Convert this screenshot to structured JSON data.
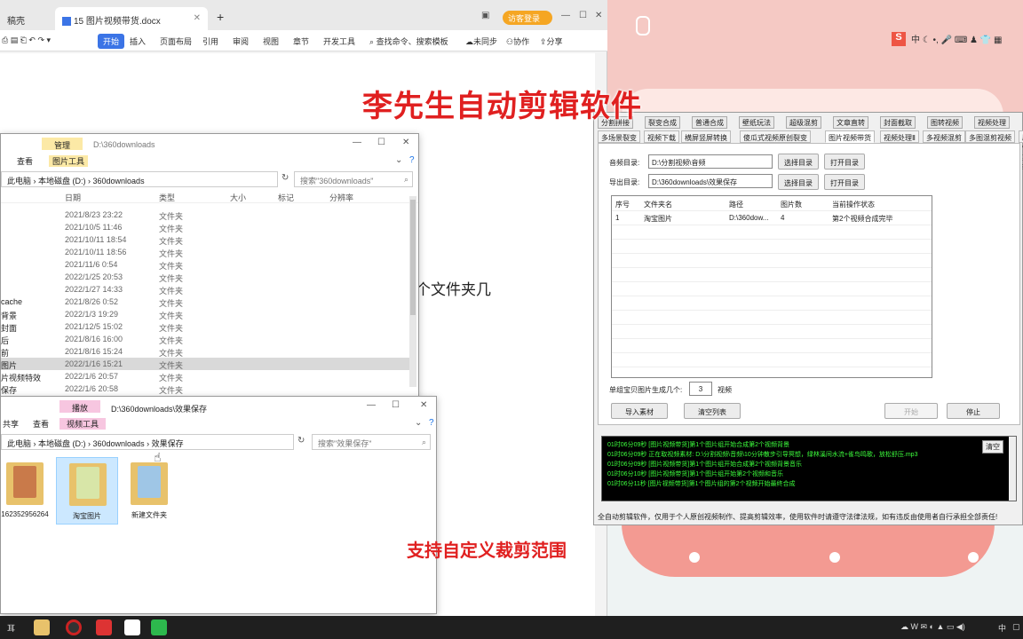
{
  "wps": {
    "tab_partial": "稿壳",
    "tab_doc": "15 图片视频带货.docx",
    "tab_add": "+",
    "guest_login": "访客登录",
    "ribbon": [
      "开始",
      "插入",
      "页面布局",
      "引用",
      "审阅",
      "视图",
      "章节",
      "开发工具"
    ],
    "search_hint": "查找命令、搜索模板",
    "sync": "未同步",
    "collab": "协作",
    "share": "分享",
    "doc_text": "个文件夹几"
  },
  "explorer1": {
    "manage": "管理",
    "path_title": "D:\\360downloads",
    "tabs": [
      "查看",
      "图片工具"
    ],
    "address": [
      "此电脑",
      "本地磁盘 (D:)",
      "360downloads"
    ],
    "search_placeholder": "搜索\"360downloads\"",
    "columns": [
      "日期",
      "类型",
      "大小",
      "标记",
      "分辨率"
    ],
    "rows": [
      {
        "name": "",
        "date": "2021/8/23 23:22",
        "type": "文件夹"
      },
      {
        "name": "",
        "date": "2021/10/5 11:46",
        "type": "文件夹"
      },
      {
        "name": "",
        "date": "2021/10/11 18:54",
        "type": "文件夹"
      },
      {
        "name": "",
        "date": "2021/10/11 18:56",
        "type": "文件夹"
      },
      {
        "name": "",
        "date": "2021/11/6 0:54",
        "type": "文件夹"
      },
      {
        "name": "",
        "date": "2022/1/25 20:53",
        "type": "文件夹"
      },
      {
        "name": "",
        "date": "2022/1/27 14:33",
        "type": "文件夹"
      },
      {
        "name": "cache",
        "date": "2021/8/26 0:52",
        "type": "文件夹"
      },
      {
        "name": "背景",
        "date": "2022/1/3 19:29",
        "type": "文件夹"
      },
      {
        "name": "封面",
        "date": "2021/12/5 15:02",
        "type": "文件夹"
      },
      {
        "name": "后",
        "date": "2021/8/16 16:00",
        "type": "文件夹"
      },
      {
        "name": "前",
        "date": "2021/8/16 15:24",
        "type": "文件夹"
      },
      {
        "name": "图片",
        "date": "2022/1/16 15:21",
        "type": "文件夹",
        "selected": true
      },
      {
        "name": "片视频特效",
        "date": "2022/1/6 20:57",
        "type": "文件夹"
      },
      {
        "name": "保存",
        "date": "2022/1/6 20:58",
        "type": "文件夹"
      }
    ]
  },
  "explorer2": {
    "manage": "播放",
    "path_title": "D:\\360downloads\\效果保存",
    "tabs": [
      "共享",
      "查看",
      "视频工具"
    ],
    "address": [
      "此电脑",
      "本地磁盘 (D:)",
      "360downloads",
      "效果保存"
    ],
    "search_placeholder": "搜索\"效果保存\"",
    "items": [
      {
        "label": "162352956264"
      },
      {
        "label": "淘宝图片",
        "selected": true
      },
      {
        "label": "新建文件夹"
      }
    ]
  },
  "app": {
    "toolbar": [
      "分割拼接",
      "裂变合成",
      "普通合成",
      "壁纸玩法",
      "超级混剪",
      "文章直转",
      "封面截取",
      "图转视频",
      "视频处理"
    ],
    "tabs": [
      "多场景裂变",
      "视频下载",
      "横屏竖屏转换",
      "傻瓜式视频原创裂变",
      "图片视频带货",
      "视频处理Ⅱ",
      "多视频混剪",
      "多图混剪视频",
      "剧情剪辑"
    ],
    "active_tab": 4,
    "audio_label": "音频目录:",
    "audio_value": "D:\\分割视频\\音频",
    "export_label": "导出目录:",
    "export_value": "D:\\360downloads\\效果保存",
    "select_dir": "选择目录",
    "open_dir": "打开目录",
    "grid_headers": [
      "序号",
      "文件夹名",
      "路径",
      "图片数",
      "当前操作状态"
    ],
    "grid_row": [
      "1",
      "淘宝图片",
      "D:\\360dow...",
      "4",
      "第2个视频合成完毕"
    ],
    "per_group_label": "单组宝贝图片生成几个:",
    "per_group_value": "3",
    "per_group_unit": "视频",
    "import_btn": "导入素材",
    "clear_btn": "清空列表",
    "start_btn": "开始",
    "stop_btn": "停止",
    "log_clear": "清空",
    "log": [
      "01时06分09秒 [图片视频带货]第1个图片组开始合成第2个视频背景",
      "01时06分09秒 正在取视频素材: D:\\分割视频\\音频\\10分钟散步引导冥想，绿林溪间水流+雀鸟鸣歌，放松舒压.mp3",
      "01时06分09秒 [图片视频带货]第1个图片组开始合成第2个视频背景音乐",
      "01时06分10秒 [图片视频带货]第1个图片组开始第2个视频和音乐",
      "01时06分11秒 [图片视频带货]第1个图片组的第2个视频开始最终合成"
    ],
    "footer": "全自动剪辑软件，仅用于个人原创视频制作、提高剪辑效率，使用软件时请遵守法律法规，如有违反由使用者自行承担全部责任!"
  },
  "overlay": {
    "title": "李先生自动剪辑软件",
    "subtitle": "支持自定义裁剪范围"
  },
  "tray": {
    "ime": "中",
    "taskbar_lang": "中",
    "taskbar_left": "耳"
  },
  "colors": {
    "overlay_red": "#e02020",
    "log_green": "#3dff3d",
    "ribbon_blue": "#3b74e6",
    "guest_orange": "#f5a623"
  }
}
